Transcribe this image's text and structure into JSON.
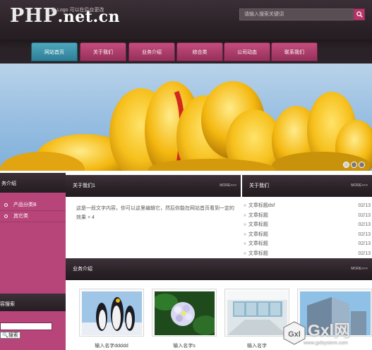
{
  "header": {
    "logo_main": "PHP",
    "logo_sub": ".net.cn",
    "logo_note": "此 Logo 可以在后台更改",
    "search_placeholder": "请输入搜索关键词"
  },
  "nav": [
    {
      "label": "网站首页",
      "active": true
    },
    {
      "label": "关于我们",
      "active": false
    },
    {
      "label": "业务介绍",
      "active": false
    },
    {
      "label": "综合类",
      "active": false
    },
    {
      "label": "公司动态",
      "active": false
    },
    {
      "label": "联系我们",
      "active": false
    }
  ],
  "banner": {
    "slides": 3,
    "current": 1
  },
  "sidebar": {
    "title": "务介绍",
    "items": [
      "产品分类B",
      "其它类"
    ],
    "search_title": "容搜索",
    "search_button": "搜索"
  },
  "about": {
    "title": "关于我们1",
    "more": "MORE>>>",
    "text": "这是一段文字内容，你可以这里编辑它，然后你能在网站首页看到一定的效果 + 4"
  },
  "news": {
    "title": "关于我们",
    "more": "MORE>>>",
    "items": [
      {
        "title": "文章标题dsf",
        "date": "02/13"
      },
      {
        "title": "文章标题",
        "date": "02/13"
      },
      {
        "title": "文章标题",
        "date": "02/13"
      },
      {
        "title": "文章标题",
        "date": "02/13"
      },
      {
        "title": "文章标题",
        "date": "02/13"
      },
      {
        "title": "文章标题",
        "date": "02/13"
      }
    ]
  },
  "business": {
    "title": "业务介绍",
    "more": "MORE>>>",
    "products": [
      {
        "name": "输入名字ddddd",
        "image": "penguins"
      },
      {
        "name": "输入名字s",
        "image": "hydrangea"
      },
      {
        "name": "输入名字",
        "image": "office-hall"
      },
      {
        "name": "",
        "image": "building"
      }
    ]
  },
  "watermark": {
    "text": "Gxl网",
    "url": "www.gxlsystem.com"
  },
  "colors": {
    "accent": "#b8457a",
    "nav_active": "#3b93ab",
    "dark": "#2b2228"
  }
}
